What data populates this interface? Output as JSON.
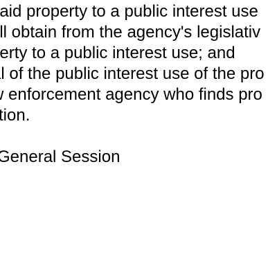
{
  "document": {
    "lines": [
      "slaid property to a public interest use",
      "all obtain from the agency's legislativ",
      "perty to a public interest use; and",
      "al of the public interest use of the pro",
      "w enforcement agency who finds pro",
      "ction.",
      "General Session"
    ]
  }
}
